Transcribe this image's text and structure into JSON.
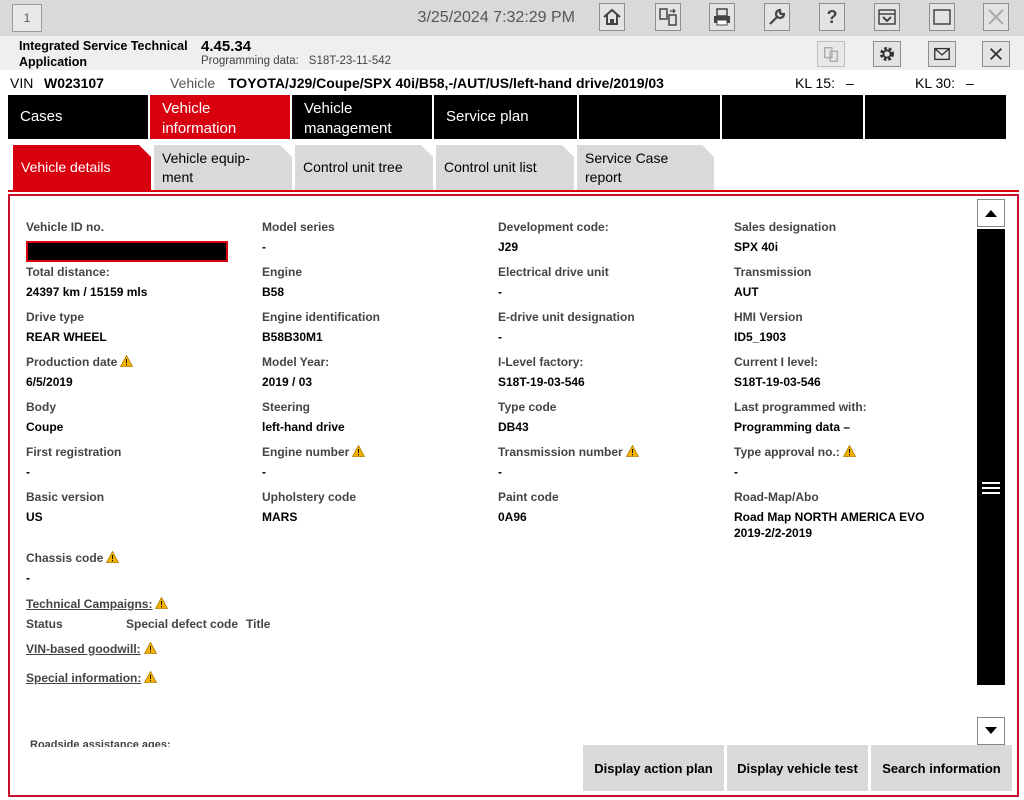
{
  "topbar": {
    "window_number": "1",
    "datetime": "3/25/2024 7:32:29 PM",
    "icons": [
      "home-icon",
      "document-swap-icon",
      "print-icon",
      "wrench-icon",
      "help-icon",
      "download-icon",
      "window-icon",
      "close-icon"
    ]
  },
  "appbar": {
    "app_name": "Integrated Service Technical Application",
    "version": "4.45.34",
    "programming_label": "Programming data:",
    "programming_value": "S18T-23-11-542",
    "icons": [
      "document-copy-icon",
      "gear-icon",
      "mail-icon",
      "close-icon"
    ]
  },
  "vinbar": {
    "vin_label": "VIN",
    "vin_value": "W023107",
    "vehicle_label": "Vehicle",
    "vehicle_value": "TOYOTA/J29/Coupe/SPX 40i/B58,-/AUT/US/left-hand drive/2019/03",
    "kl15_label": "KL 15:",
    "kl15_value": "–",
    "kl30_label": "KL 30:",
    "kl30_value": "–"
  },
  "nav": {
    "items": [
      {
        "label": "Cases"
      },
      {
        "label": "Vehicle information"
      },
      {
        "label": "Vehicle management"
      },
      {
        "label": "Service plan"
      }
    ]
  },
  "tabs": [
    {
      "label": "Vehicle details"
    },
    {
      "label": "Vehicle equip-ment"
    },
    {
      "label": "Control unit tree"
    },
    {
      "label": "Control unit list"
    },
    {
      "label": "Service Case report"
    }
  ],
  "details": {
    "col1": [
      {
        "label": "Vehicle ID no.",
        "value": ""
      },
      {
        "label": "Total distance:",
        "value": "24397 km / 15159 mls"
      },
      {
        "label": "Drive type",
        "value": "REAR WHEEL"
      },
      {
        "label": "Production date",
        "value": "6/5/2019"
      },
      {
        "label": "Body",
        "value": "Coupe"
      },
      {
        "label": "First registration",
        "value": "-"
      },
      {
        "label": "Basic version",
        "value": "US"
      },
      {
        "label": "Chassis code",
        "value": "-"
      }
    ],
    "col2": [
      {
        "label": "Model series",
        "value": "-"
      },
      {
        "label": "Engine",
        "value": "B58"
      },
      {
        "label": "Engine identification",
        "value": "B58B30M1"
      },
      {
        "label": "Model Year:",
        "value": "2019 / 03"
      },
      {
        "label": "Steering",
        "value": "left-hand drive"
      },
      {
        "label": "Engine number",
        "value": "-"
      },
      {
        "label": "Upholstery code",
        "value": "MARS"
      }
    ],
    "col3": [
      {
        "label": "Development code:",
        "value": "J29"
      },
      {
        "label": "Electrical drive unit",
        "value": "-"
      },
      {
        "label": "E-drive unit designation",
        "value": "-"
      },
      {
        "label": "I-Level factory:",
        "value": "S18T-19-03-546"
      },
      {
        "label": "Type code",
        "value": "DB43"
      },
      {
        "label": "Transmission number",
        "value": "-"
      },
      {
        "label": "Paint code",
        "value": "0A96"
      }
    ],
    "col4": [
      {
        "label": "Sales designation",
        "value": "SPX 40i"
      },
      {
        "label": "Transmission",
        "value": "AUT"
      },
      {
        "label": "HMI Version",
        "value": "ID5_1903"
      },
      {
        "label": "Current I level:",
        "value": "S18T-19-03-546"
      },
      {
        "label": "Last programmed with:",
        "value": "Programming data –"
      },
      {
        "label": "Type approval no.:",
        "value": "-"
      },
      {
        "label": "Road-Map/Abo",
        "value": "Road Map NORTH AMERICA EVO",
        "value2": "2019-2/2-2019"
      }
    ]
  },
  "campaigns": {
    "title": "Technical Campaigns:",
    "col_status": "Status",
    "col_defect": "Special defect code",
    "col_title": "Title",
    "goodwill": "VIN-based goodwill:",
    "special_info": "Special information:",
    "cutoff": "Roadside assistance ages:"
  },
  "buttons": {
    "action_plan": "Display action plan",
    "vehicle_test": "Display vehicle test",
    "search_info": "Search information"
  },
  "colors": {
    "accent": "#d8000f",
    "nav_bg": "#000000",
    "warn": "#f2b400"
  }
}
